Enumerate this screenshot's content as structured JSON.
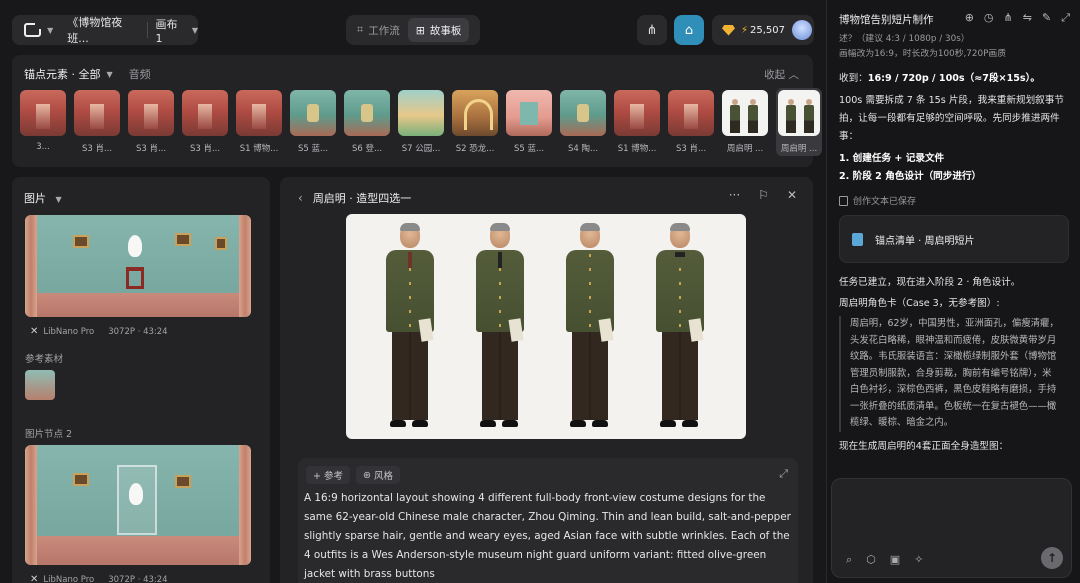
{
  "topbar": {
    "doc_title": "《博物馆夜班...",
    "canvas_label": "画布 1",
    "modes": [
      {
        "label": "工作流",
        "icon": "workflow-icon",
        "active": false
      },
      {
        "label": "故事板",
        "icon": "storyboard-icon",
        "active": true
      }
    ],
    "credits": "25,507",
    "shop_color": "#2f8fb8",
    "gem_color": "#f2b333"
  },
  "strip": {
    "tab_elements": "锚点元素 · 全部",
    "tab_audio": "音频",
    "collapse_label": "收起",
    "thumbs": [
      {
        "label": "3...",
        "style": "img-red"
      },
      {
        "label": "S3 肖...",
        "style": "img-red"
      },
      {
        "label": "S3 肖...",
        "style": "img-red"
      },
      {
        "label": "S3 肖...",
        "style": "img-red"
      },
      {
        "label": "S1 博物...",
        "style": "img-red"
      },
      {
        "label": "S5 蓝...",
        "style": "img-teal"
      },
      {
        "label": "S6 登...",
        "style": "img-teal"
      },
      {
        "label": "S7 公园...",
        "style": "img-park"
      },
      {
        "label": "S2 恐龙...",
        "style": "img-arch"
      },
      {
        "label": "S5 蓝...",
        "style": "img-pink"
      },
      {
        "label": "S4 陶...",
        "style": "img-teal"
      },
      {
        "label": "S1 博物...",
        "style": "img-red"
      },
      {
        "label": "S3 肖...",
        "style": "img-red"
      },
      {
        "label": "周启明 ...",
        "style": "img-white"
      },
      {
        "label": "周启明 ...",
        "style": "img-white"
      }
    ]
  },
  "left": {
    "title": "图片",
    "image1_meta": {
      "model": "LibNano Pro",
      "res": "3072P · 43:24"
    },
    "ref_label": "参考素材",
    "node2_label": "图片节点 2",
    "image2_meta": {
      "model": "LibNano Pro",
      "res": "3072P · 43:24"
    }
  },
  "center": {
    "title": "周启明 · 造型四选一",
    "chip_ref": "+ 参考",
    "chip_style": "风格",
    "prompt": "A 16:9 horizontal layout showing 4 different full-body front-view costume designs for the same 62-year-old Chinese male character, Zhou Qiming. Thin and lean build, salt-and-pepper slightly sparse hair, gentle and weary eyes, aged Asian face with subtle wrinkles. Each of the 4 outfits is a Wes Anderson-style museum night guard uniform variant: fitted olive-green jacket with brass buttons"
  },
  "chat": {
    "title": "博物馆告别短片制作",
    "lines_top": [
      "述？（建议 4:3 / 1080p / 30s）",
      "画幅改为16:9，时长改为100秒,720P画质"
    ],
    "received_prefix": "收到：",
    "received_bold": "16:9 / 720p / 100s（≈7段×15s）。",
    "para1": "100s 需要拆成 7 条 15s 片段，我来重新规划叙事节拍，让每一段都有足够的空间呼吸。先同步推进两件事：",
    "steps": [
      "1. 创建任务 + 记录文件",
      "2. 阶段 2 角色设计（同步进行）"
    ],
    "saved_label": "创作文本已保存",
    "card_label": "锚点清单 · 周启明短片",
    "task_line": "任务已建立，现在进入阶段 2 · 角色设计。",
    "role_card": "周启明角色卡（Case 3，无参考图）:",
    "quote_lines": [
      "周启明，62岁，中国男性，亚洲面孔，偏瘦清癯，",
      "头发花白略稀，眼神温和而疲倦，皮肤微黄带岁月",
      "纹路。韦氏服装语言：深橄榄绿制服外套（博物馆",
      "管理员制服款，合身剪裁，胸前有编号铭牌），米",
      "白色衬衫，深棕色西裤，黑色皮鞋略有磨损，手持",
      "一张折叠的纸质清单。色板统一在复古褪色——橄",
      "榄绿、暖棕、暗金之内。"
    ],
    "generating": "现在生成周启明的4套正面全身造型图："
  }
}
